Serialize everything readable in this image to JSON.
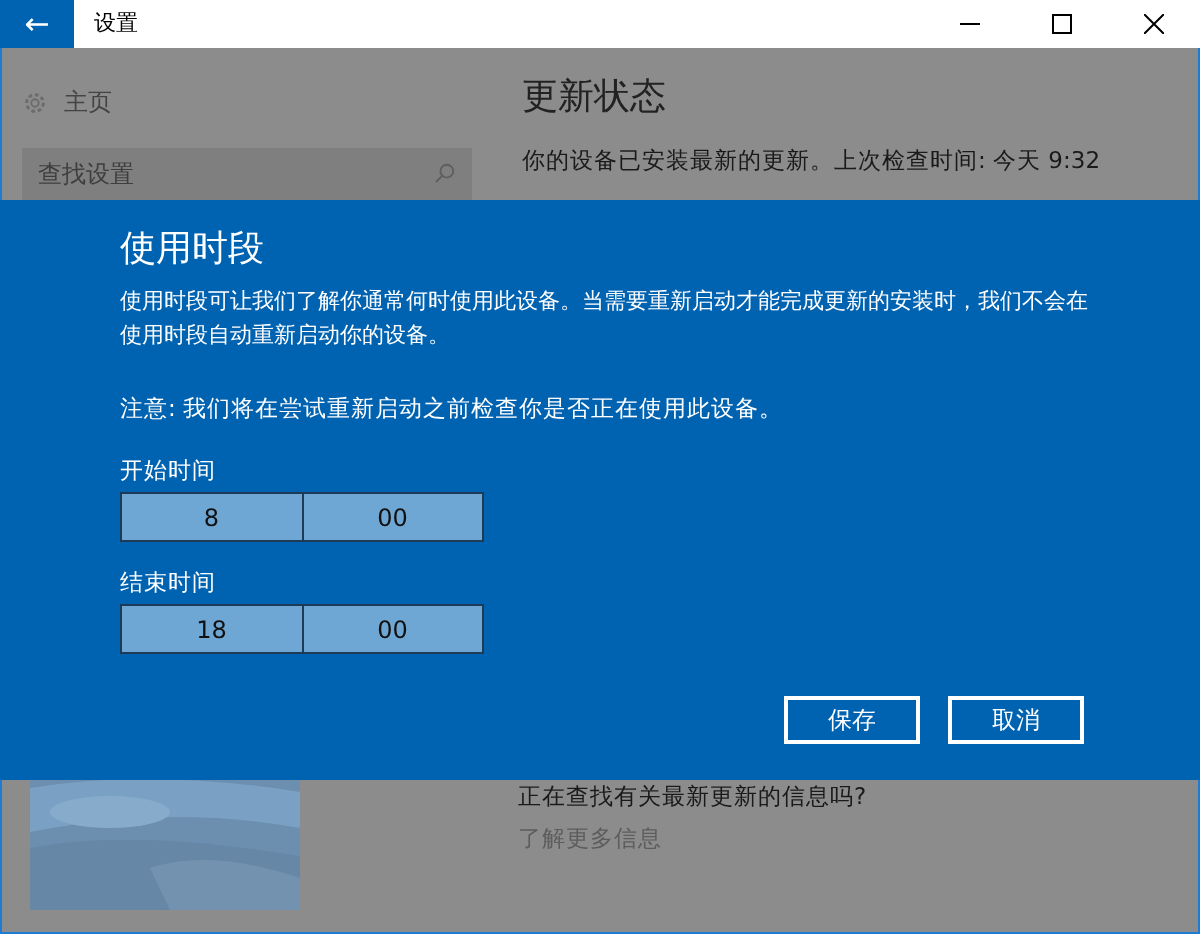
{
  "window": {
    "title": "设置",
    "back_glyph": "←"
  },
  "sidebar": {
    "home": "主页",
    "search": {
      "placeholder": "查找设置"
    }
  },
  "main": {
    "heading": "更新状态",
    "status": "你的设备已安装最新的更新。上次检查时间: 今天 9:32",
    "question": "正在查找有关最新更新的信息吗?",
    "link": "了解更多信息"
  },
  "dialog": {
    "title": "使用时段",
    "description": "使用时段可让我们了解你通常何时使用此设备。当需要重新启动才能完成更新的安装时，我们不会在使用时段自动重新启动你的设备。",
    "note": "注意: 我们将在尝试重新启动之前检查你是否正在使用此设备。",
    "times": [
      {
        "label": "开始时间",
        "hour": "8",
        "minute": "00"
      },
      {
        "label": "结束时间",
        "hour": "18",
        "minute": "00"
      }
    ],
    "buttons": [
      "保存",
      "取消"
    ]
  }
}
